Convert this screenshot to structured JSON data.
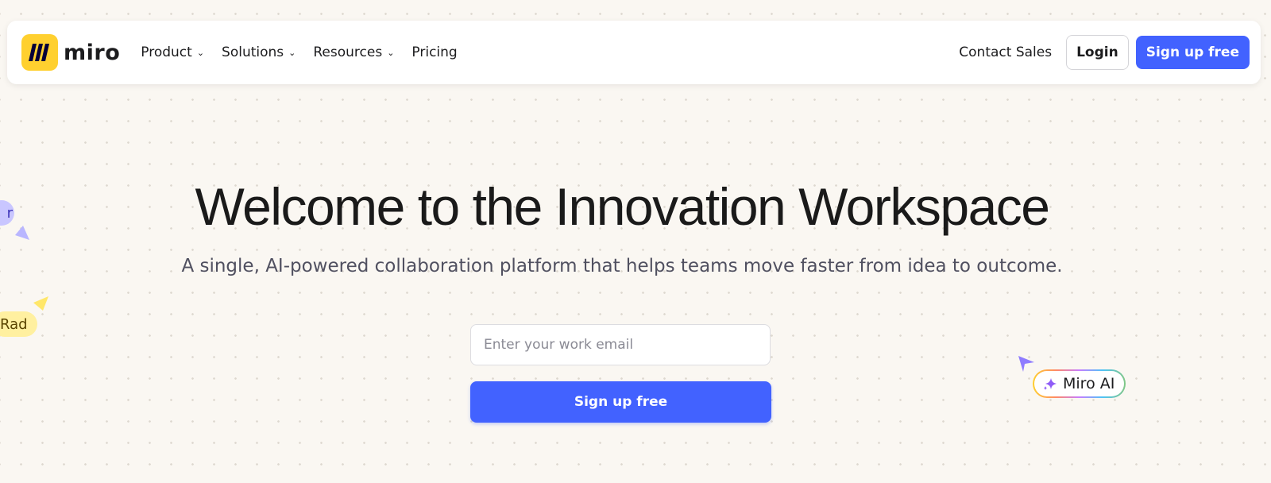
{
  "nav": {
    "brand": "miro",
    "menu": [
      {
        "label": "Product",
        "has_dropdown": true
      },
      {
        "label": "Solutions",
        "has_dropdown": true
      },
      {
        "label": "Resources",
        "has_dropdown": true
      },
      {
        "label": "Pricing",
        "has_dropdown": false
      }
    ],
    "contact_sales": "Contact Sales",
    "login": "Login",
    "signup": "Sign up free"
  },
  "hero": {
    "title": "Welcome to the Innovation Workspace",
    "subtitle": "A single, AI-powered collaboration platform that helps teams move faster from idea to outcome.",
    "email_placeholder": "Enter your work email",
    "signup": "Sign up free"
  },
  "floating": {
    "tag_purple": "r",
    "tag_yellow": "Rad",
    "ai_label": "Miro AI"
  },
  "colors": {
    "accent": "#4262ff",
    "logo": "#ffd02f",
    "background": "#faf7f2"
  }
}
